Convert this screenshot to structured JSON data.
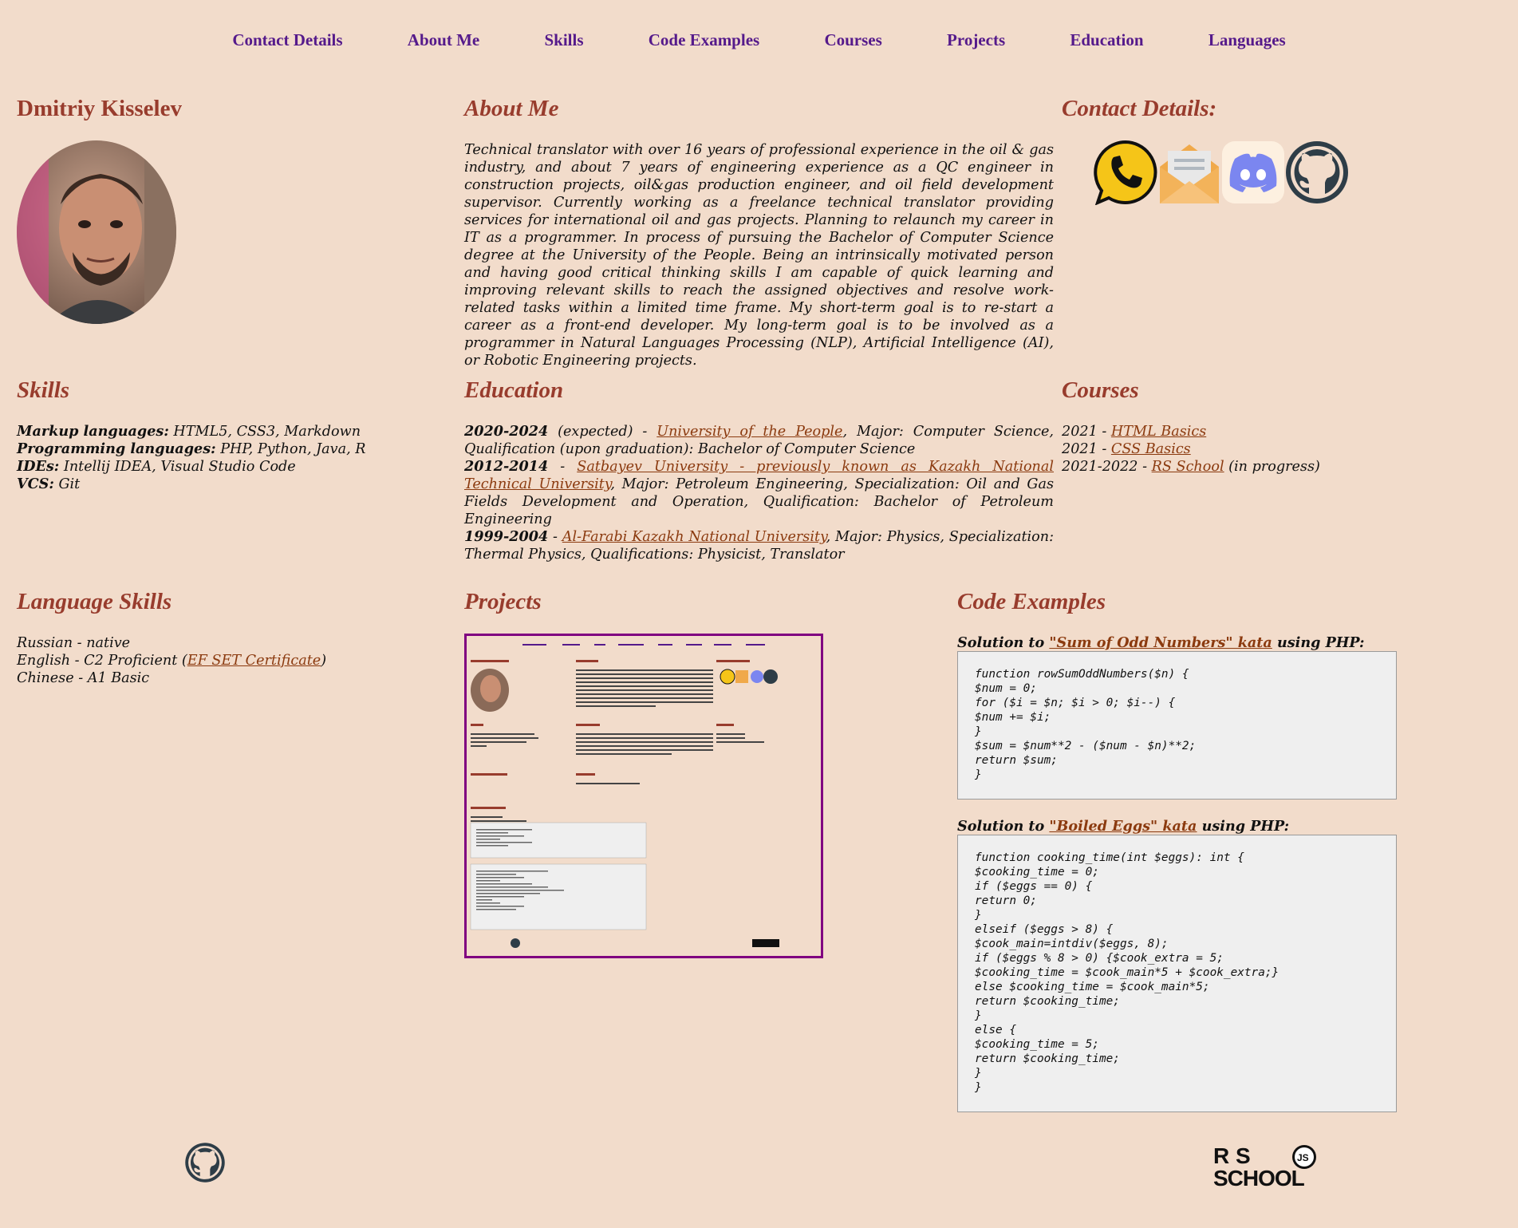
{
  "nav": {
    "items": [
      "Contact Details",
      "About Me",
      "Skills",
      "Code Examples",
      "Courses",
      "Projects",
      "Education",
      "Languages"
    ]
  },
  "profile": {
    "name": "Dmitriy Kisselev"
  },
  "about": {
    "title": "About Me",
    "text": "Technical translator with over 16 years of professional experience in the oil & gas industry, and about 7 years of engineering experience as a QC engineer in construction projects, oil&gas production engineer, and oil field development supervisor. Currently working as a freelance technical translator providing services for international oil and gas projects. Planning to relaunch my career in IT as a programmer. In process of pursuing the Bachelor of Computer Science degree at the University of the People. Being an intrinsically motivated person and having good critical thinking skills I am capable of quick learning and improving relevant skills to reach the assigned objectives and resolve work-related tasks within a limited time frame. My short-term goal is to re-start a career as a front-end developer. My long-term goal is to be involved as a programmer in Natural Languages Processing (NLP), Artificial Intelligence (AI), or Robotic Engineering projects."
  },
  "contact": {
    "title": "Contact Details:",
    "icons": [
      "phone-icon",
      "email-icon",
      "discord-icon",
      "github-icon"
    ]
  },
  "skills": {
    "title": "Skills",
    "items": [
      {
        "label": "Markup languages:",
        "value": " HTML5, CSS3, Markdown"
      },
      {
        "label": "Programming languages:",
        "value": " PHP, Python, Java, R"
      },
      {
        "label": "IDEs:",
        "value": " Intellij IDEA, Visual Studio Code"
      },
      {
        "label": "VCS:",
        "value": " Git"
      }
    ]
  },
  "education": {
    "title": "Education",
    "items": [
      {
        "years": "2020-2024",
        "pre": " (expected) - ",
        "link": "University of the People",
        "post": ", Major: Computer Science, Qualification (upon graduation): Bachelor of Computer Science"
      },
      {
        "years": "2012-2014",
        "pre": " - ",
        "link": "Satbayev University - previously known as Kazakh National Technical University",
        "post": ", Major: Petroleum Engineering, Specialization: Oil and Gas Fields Development and Operation, Qualification: Bachelor of Petroleum Engineering"
      },
      {
        "years": "1999-2004",
        "pre": " - ",
        "link": "Al-Farabi Kazakh National University",
        "post": ", Major: Physics, Specialization: Thermal Physics, Qualifications: Physicist, Translator"
      }
    ]
  },
  "courses": {
    "title": "Courses",
    "items": [
      {
        "year": "2021 - ",
        "link": "HTML Basics",
        "post": ""
      },
      {
        "year": "2021 - ",
        "link": "CSS Basics",
        "post": ""
      },
      {
        "year": "2021-2022 - ",
        "link": "RS School",
        "post": " (in progress)"
      }
    ]
  },
  "languages": {
    "title": "Language Skills",
    "items": [
      {
        "text": "Russian - native",
        "link": "",
        "post": ""
      },
      {
        "text": "English - C2 Proficient (",
        "link": "EF SET Certificate",
        "post": ")"
      },
      {
        "text": "Chinese - A1 Basic",
        "link": "",
        "post": ""
      }
    ]
  },
  "projects": {
    "title": "Projects"
  },
  "code": {
    "title": "Code Examples",
    "examples": [
      {
        "pre": "Solution to ",
        "link": "\"Sum of Odd Numbers\" kata",
        "post": " using PHP:",
        "code": "function rowSumOddNumbers($n) {\n$num = 0;\nfor ($i = $n; $i > 0; $i--) {\n$num += $i;\n}\n$sum = $num**2 - ($num - $n)**2;\nreturn $sum;\n}"
      },
      {
        "pre": "Solution to ",
        "link": "\"Boiled Eggs\" kata",
        "post": " using PHP:",
        "code": "function cooking_time(int $eggs): int {\n$cooking_time = 0;\nif ($eggs == 0) {\nreturn 0;\n}\nelseif ($eggs > 8) {\n$cook_main=intdiv($eggs, 8);\nif ($eggs % 8 > 0) {$cook_extra = 5;\n$cooking_time = $cook_main*5 + $cook_extra;}\nelse $cooking_time = $cook_main*5;\nreturn $cooking_time;\n}\nelse {\n$cooking_time = 5;\nreturn $cooking_time;\n}\n}"
      }
    ]
  },
  "footer": {
    "logo_text_top": "R S",
    "logo_text_bottom": "SCHOOL",
    "logo_badge": "JS"
  }
}
